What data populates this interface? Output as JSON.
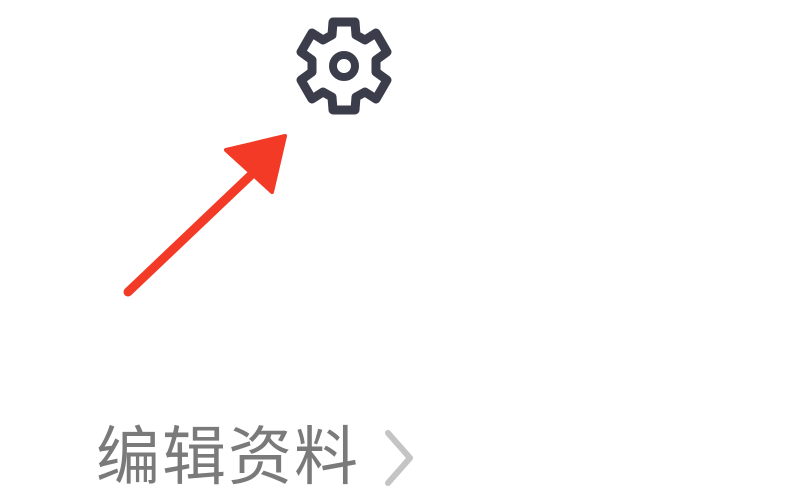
{
  "settings": {
    "icon": "gear-icon",
    "icon_color": "#3b3d4b"
  },
  "annotation": {
    "icon": "red-arrow-icon",
    "color": "#f23a26"
  },
  "profile": {
    "edit_label": "编辑资料",
    "chevron_icon": "chevron-right-icon",
    "text_color": "#7a7a7a",
    "chevron_color": "#c4c4c4"
  }
}
